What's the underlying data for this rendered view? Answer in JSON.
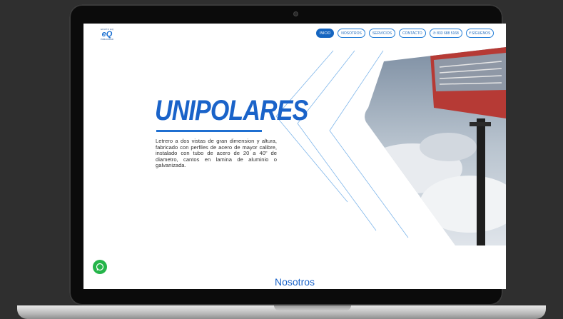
{
  "logo": {
    "top_text": "GRUPO EQ",
    "mark": "eQ",
    "bottom_text": "PUBLICIDAD"
  },
  "nav": {
    "items": [
      {
        "label": "INICIO",
        "active": true
      },
      {
        "label": "NOSOTROS",
        "active": false
      },
      {
        "label": "SERVICIOS",
        "active": false
      },
      {
        "label": "CONTACTO",
        "active": false
      },
      {
        "label": "833 688 5168",
        "icon": "phone-icon",
        "active": false
      },
      {
        "label": "SÍGUENOS",
        "icon": "facebook-icon",
        "active": false
      }
    ]
  },
  "hero": {
    "title": "UNIPOLARES",
    "description": "Letrero a dos vistas de gran dimension y altura, fabricado con perfiles de acero de mayor calibre, instalado con tubo de acero de 20 a 40\" de diametro, cantos en lamina de  aluminio o galvanizada."
  },
  "section": {
    "title": "Nosotros"
  },
  "colors": {
    "accent": "#1a63c9",
    "whatsapp": "#25b54a",
    "background": "#2f2f2f"
  },
  "floating": {
    "icon": "whatsapp-icon"
  }
}
